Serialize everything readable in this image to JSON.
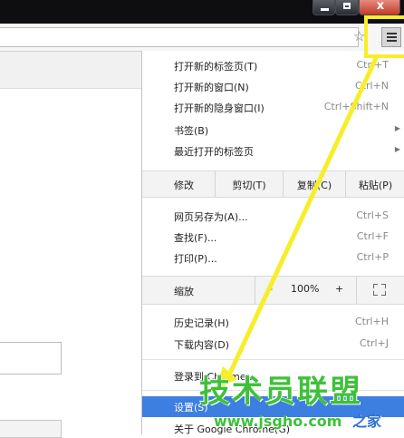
{
  "window": {
    "close_glyph": "x"
  },
  "toolbar": {
    "star_glyph": "☆"
  },
  "menu": {
    "items_top": [
      {
        "label": "打开新的标签页(T)",
        "shortcut": "Ctrl+T"
      },
      {
        "label": "打开新的窗口(N)",
        "shortcut": "Ctrl+N"
      },
      {
        "label": "打开新的隐身窗口(I)",
        "shortcut": "Ctrl+Shift+N"
      },
      {
        "label": "书签(B)",
        "shortcut": ""
      },
      {
        "label": "最近打开的标签页",
        "shortcut": ""
      }
    ],
    "edit": {
      "label": "修改",
      "cut": "剪切(T)",
      "copy": "复制(C)",
      "paste": "粘贴(P)"
    },
    "items_mid": [
      {
        "label": "网页另存为(A)...",
        "shortcut": "Ctrl+S"
      },
      {
        "label": "查找(F)...",
        "shortcut": "Ctrl+F"
      },
      {
        "label": "打印(P)...",
        "shortcut": "Ctrl+P"
      }
    ],
    "zoom": {
      "label": "缩放",
      "minus": "-",
      "value": "100%",
      "plus": "+"
    },
    "items_low": [
      {
        "label": "历史记录(H)",
        "shortcut": "Ctrl+H"
      },
      {
        "label": "下载内容(D)",
        "shortcut": "Ctrl+J"
      }
    ],
    "signin": "登录到 Chrome...",
    "settings": "设置(S)",
    "about": "关于 Google Chrome(G)"
  },
  "watermark": {
    "text": "技术员联盟",
    "url": "www.jsgho.com",
    "suffix": "之家"
  },
  "colors": {
    "highlight": "#3d7fe0",
    "annotation": "#f7ee2a",
    "watermark": "#3ec13a"
  }
}
